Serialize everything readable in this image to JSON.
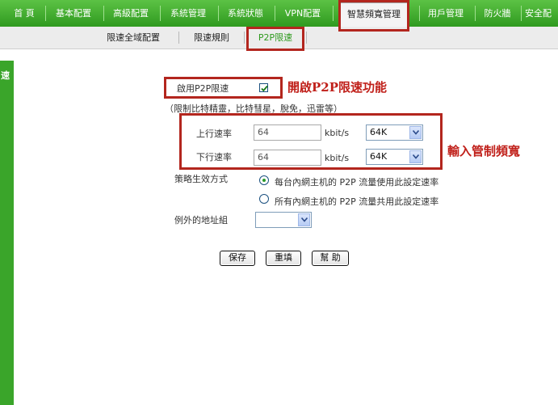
{
  "top_nav": {
    "tabs": [
      "首 頁",
      "基本配置",
      "高級配置",
      "系統管理",
      "系統狀態",
      "VPN配置",
      "智慧頻寬管理",
      "用戶管理",
      "防火牆",
      "安全配"
    ],
    "active": "智慧頻寬管理"
  },
  "sub_nav": {
    "tabs": [
      "限速全域配置",
      "限速規則",
      "P2P限速"
    ],
    "active": "P2P限速"
  },
  "side": {
    "label": "速"
  },
  "form": {
    "enable_label": "啟用P2P限速",
    "enable_checked": true,
    "note": "（限制比特精靈，比特彗星，脫免，迅雷等）",
    "upload": {
      "label": "上行速率",
      "value": "64",
      "unit": "kbit/s",
      "select": "64K"
    },
    "download": {
      "label": "下行速率",
      "value": "64",
      "unit": "kbit/s",
      "select": "64K"
    },
    "policy_label": "策略生效方式",
    "policy_options": [
      {
        "label": "每台內網主机的 P2P 流量使用此設定速率",
        "selected": true
      },
      {
        "label": "所有內網主机的 P2P 流量共用此設定速率",
        "selected": false
      }
    ],
    "exception_label": "例外的地址組",
    "exception_value": ""
  },
  "buttons": {
    "save": "保存",
    "reset": "重填",
    "help": "幫 助"
  },
  "annotations": {
    "enable_callout": "開啟P2P限速功能",
    "bandwidth_callout": "輸入管制頻寬"
  },
  "colors": {
    "nav_green": "#3aa52a",
    "callout_red": "#c0201a"
  }
}
